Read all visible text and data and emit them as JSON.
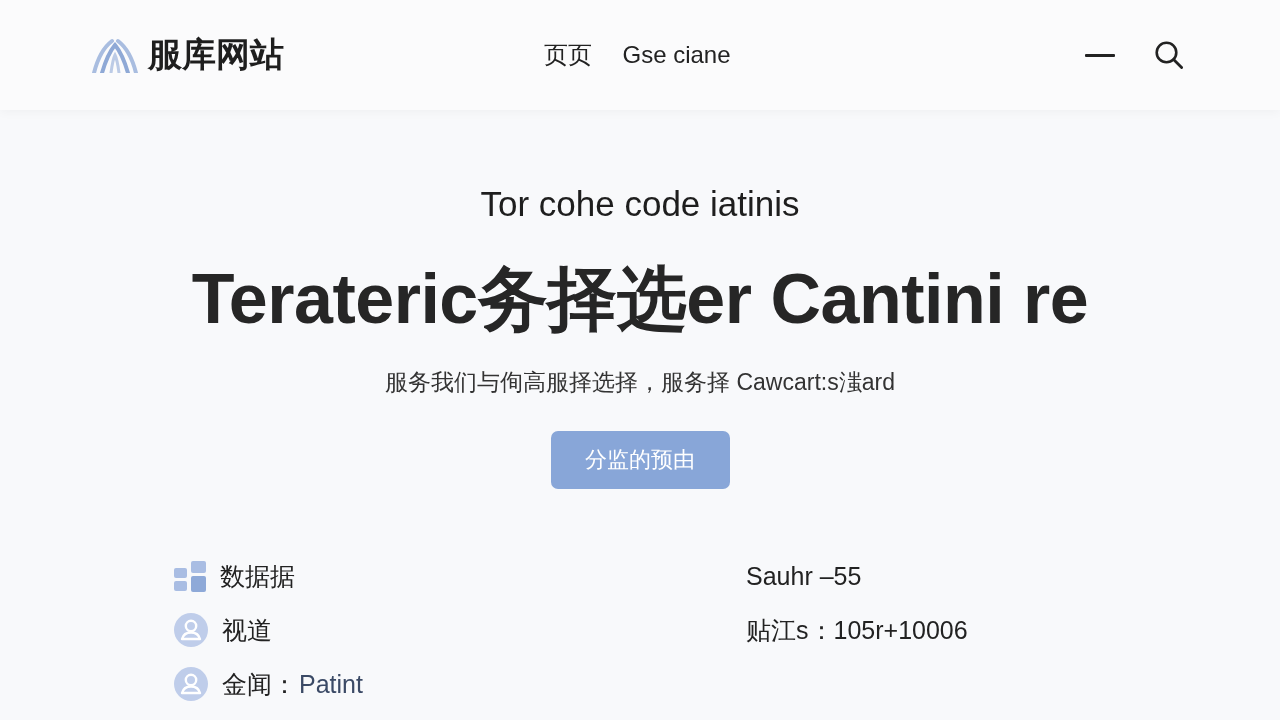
{
  "header": {
    "logo_text": "服库网站",
    "nav": [
      "页页",
      "Gse ciane"
    ]
  },
  "hero": {
    "eyebrow": "Tor cohe code iatinis",
    "title": "Terateric务择选er Cantini re",
    "subtitle": "服务我们与侚高服择选择，服务择 Cawcart:s滍ard",
    "button": "分监的预由"
  },
  "details_left": [
    {
      "kind": "data",
      "label": "数据据"
    },
    {
      "kind": "person",
      "label": "视道"
    },
    {
      "kind": "person",
      "label": "金闻：",
      "value": "Patint"
    }
  ],
  "details_right": [
    {
      "label": "Sauhr –55"
    },
    {
      "label": "贴江s：105r+10006"
    }
  ]
}
